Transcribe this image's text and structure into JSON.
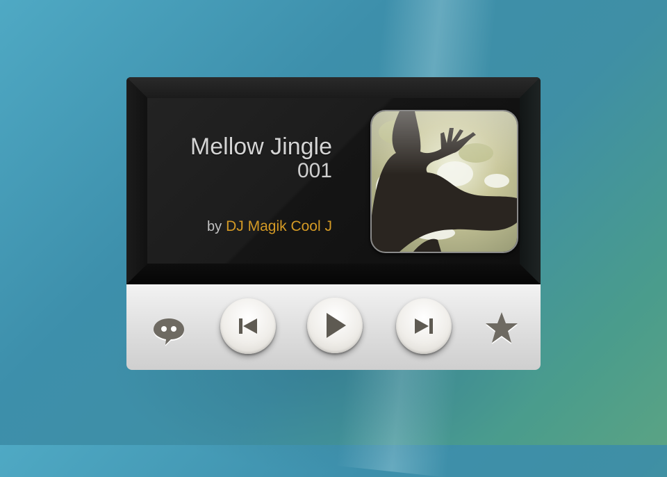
{
  "track": {
    "title": "Mellow Jingle",
    "number": "001",
    "by_label": "by",
    "artist": "DJ Magik Cool J"
  },
  "controls": {
    "chat": "speech-bubble-icon",
    "previous": "skip-previous-icon",
    "play": "play-icon",
    "next": "skip-next-icon",
    "favorite": "star-icon"
  },
  "colors": {
    "artist_accent": "#d49a25",
    "title_text": "#d4d4d4",
    "icon_gray": "#6e6a62"
  }
}
